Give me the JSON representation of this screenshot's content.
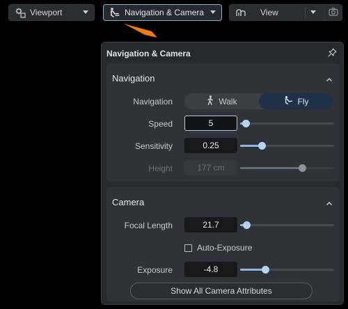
{
  "toolbar": {
    "viewport_label": "Viewport",
    "navcam_label": "Navigation & Camera",
    "view_label": "View"
  },
  "panel": {
    "title": "Navigation & Camera",
    "navigation": {
      "section_title": "Navigation",
      "mode_label": "Navigation",
      "modes": [
        "Walk",
        "Fly"
      ],
      "selected_mode": "Fly",
      "speed": {
        "label": "Speed",
        "value": "5",
        "slider_fraction": 0.06
      },
      "sensitivity": {
        "label": "Sensitivity",
        "value": "0.25",
        "slider_fraction": 0.23
      },
      "height": {
        "label": "Height",
        "value": "177 cm",
        "slider_fraction": 0.66,
        "disabled": true
      }
    },
    "camera": {
      "section_title": "Camera",
      "focal_length": {
        "label": "Focal Length",
        "value": "21.7",
        "slider_fraction": 0.07
      },
      "auto_exposure": {
        "label": "Auto-Exposure",
        "checked": false
      },
      "exposure": {
        "label": "Exposure",
        "value": "-4.8",
        "slider_fraction": 0.27
      },
      "show_all_label": "Show All Camera Attributes"
    }
  },
  "colors": {
    "accent": "#8db5e6",
    "pointer": "#f07a1a",
    "panel_bg": "#272a2d",
    "section_bg": "#2f3236"
  },
  "icons": {
    "viewport": "gear-grid-icon",
    "navcam": "fly-person-icon",
    "view": "perspective-icon",
    "camera": "camera-icon",
    "pin": "pin-icon",
    "walk": "walking-person-icon",
    "fly": "fly-person-icon"
  }
}
